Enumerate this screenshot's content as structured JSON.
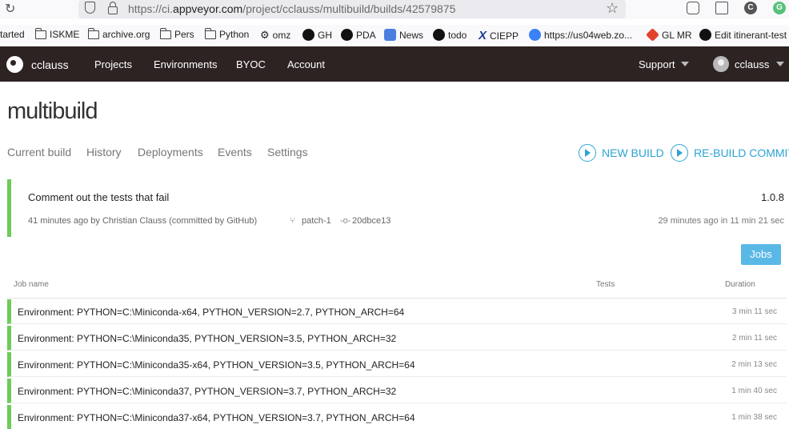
{
  "browser": {
    "url_prefix": "https://ci.",
    "url_domain": "appveyor.com",
    "url_path": "/project/cclauss/multibuild/builds/42579875",
    "extensions": [
      {
        "icon": "pocket-icon",
        "color": "#e8485b"
      },
      {
        "icon": "reader-view-icon",
        "color": "#666"
      },
      {
        "letter": "C",
        "color": "#555"
      },
      {
        "letter": "G",
        "color": "#57c17b"
      }
    ],
    "bookmarks": [
      {
        "label": "tarted",
        "icon": "none"
      },
      {
        "label": "ISKME",
        "icon": "folder-icon"
      },
      {
        "label": "archive.org",
        "icon": "folder-icon"
      },
      {
        "label": "Pers",
        "icon": "folder-icon"
      },
      {
        "label": "Python",
        "icon": "folder-icon"
      },
      {
        "label": "omz",
        "icon": "gear-icon"
      },
      {
        "label": "GH",
        "icon": "github-icon"
      },
      {
        "label": "PDA",
        "icon": "github-icon"
      },
      {
        "label": "News",
        "icon": "google-news-icon"
      },
      {
        "label": "todo",
        "icon": "github-icon"
      },
      {
        "label": "CIEPP",
        "icon": "x-icon"
      },
      {
        "label": "https://us04web.zo...",
        "icon": "zoom-icon"
      },
      {
        "label": "GL MR",
        "icon": "gitlab-icon"
      },
      {
        "label": "Edit itinerant-test",
        "icon": "github-icon"
      }
    ]
  },
  "nav": {
    "brand": "cclauss",
    "items": [
      "Projects",
      "Environments",
      "BYOC",
      "Account"
    ],
    "support": "Support",
    "user": "cclauss"
  },
  "page": {
    "title": "multibuild",
    "tabs": [
      "Current build",
      "History",
      "Deployments",
      "Events",
      "Settings"
    ],
    "actions": {
      "new_build": "NEW BUILD",
      "rebuild_commit": "RE-BUILD COMMIT"
    }
  },
  "build": {
    "message": "Comment out the tests that fail",
    "version": "1.0.8",
    "author_line": "41 minutes ago by Christian Clauss (committed by GitHub)",
    "branch": "patch-1",
    "commit": "20dbce13",
    "duration": "29 minutes ago in 11 min 21 sec",
    "status_color": "#6dcb5a"
  },
  "jobs": {
    "button": "Jobs",
    "headers": {
      "name": "Job name",
      "tests": "Tests",
      "duration": "Duration"
    },
    "rows": [
      {
        "name": "Environment: PYTHON=C:\\Miniconda-x64, PYTHON_VERSION=2.7, PYTHON_ARCH=64",
        "duration": "3 min 11 sec"
      },
      {
        "name": "Environment: PYTHON=C:\\Miniconda35, PYTHON_VERSION=3.5, PYTHON_ARCH=32",
        "duration": "2 min 11 sec"
      },
      {
        "name": "Environment: PYTHON=C:\\Miniconda35-x64, PYTHON_VERSION=3.5, PYTHON_ARCH=64",
        "duration": "2 min 13 sec"
      },
      {
        "name": "Environment: PYTHON=C:\\Miniconda37, PYTHON_VERSION=3.7, PYTHON_ARCH=32",
        "duration": "1 min 40 sec"
      },
      {
        "name": "Environment: PYTHON=C:\\Miniconda37-x64, PYTHON_VERSION=3.7, PYTHON_ARCH=64",
        "duration": "1 min 38 sec"
      }
    ]
  },
  "colors": {
    "accent": "#2ea3d4",
    "nav_bg": "#2d2322",
    "success": "#6dcb5a",
    "jobs_button": "#5ab8e6"
  }
}
